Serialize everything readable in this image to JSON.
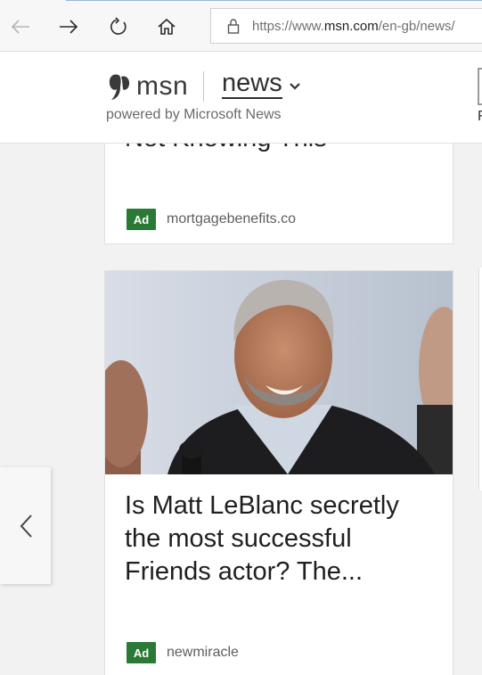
{
  "browser": {
    "url_prefix": "https://www.",
    "url_domain": "msn.com",
    "url_rest": "/en-gb/news/",
    "icons": [
      "back-icon",
      "forward-icon",
      "refresh-icon",
      "home-icon",
      "lock-icon"
    ]
  },
  "header": {
    "logo_text": "msn",
    "section_label": "news",
    "powered_by": "powered by Microsoft News",
    "right_stub": "F"
  },
  "cards": [
    {
      "title_fragment": "Not Knowing This",
      "ad_label": "Ad",
      "source": "mortgagebenefits.co"
    },
    {
      "title": "Is Matt LeBlanc secretly the most successful Friends actor? The...",
      "ad_label": "Ad",
      "source": "newmiracle"
    }
  ],
  "colors": {
    "ad_badge": "#2a7a35",
    "page_bg": "#f2f2f2"
  }
}
